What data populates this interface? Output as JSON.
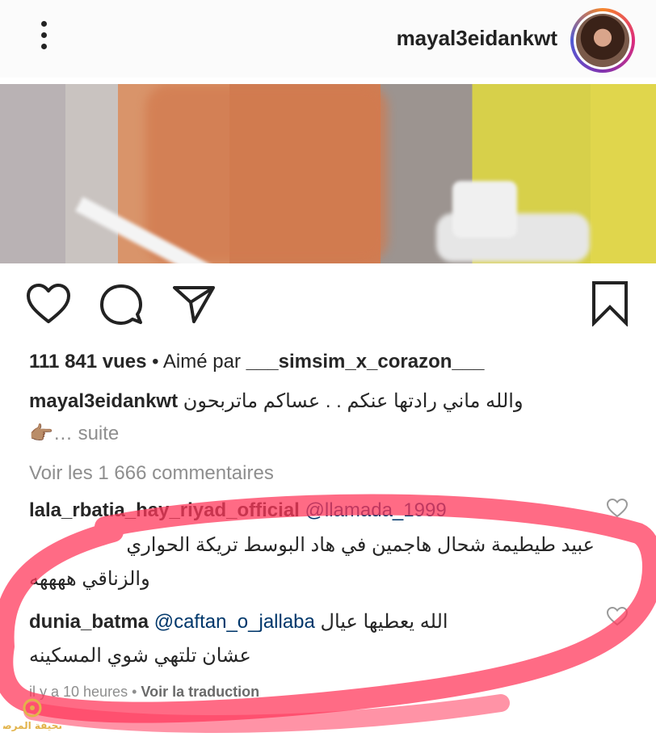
{
  "header": {
    "username": "mayal3eidankwt",
    "menu_icon": "more-vertical-icon"
  },
  "post": {
    "views_count": "111 841 vues",
    "liked_by_prefix": "• Aimé par",
    "liked_by_user": "___simsim_x_corazon___",
    "caption": {
      "username": "mayal3eidankwt",
      "text": "والله ماني رادتها عنكم . . عساكم ماتربحون",
      "continuation": "👉🏽…",
      "more": "suite"
    },
    "view_all_comments": "Voir les 1 666 commentaires"
  },
  "comments": [
    {
      "username": "lala_rbatia_hay_riyad_official",
      "mention": "@llamada_1999",
      "line1": "عبيد طيطيمة شحال هاجمين في هاد البوسط تريكة الحواري",
      "line2": "والزناقي ههههه"
    },
    {
      "username": "dunia_batma",
      "mention": "@caftan_o_jallaba",
      "inline_text": "الله يعطيها عيال",
      "line2": "عشان تلتهي  شوي المسكينه"
    }
  ],
  "comment_meta": {
    "time": "il y a 10 heures",
    "separator": "•",
    "translate": "Voir la traduction"
  },
  "watermark": {
    "text": "صحيفة المرصد"
  },
  "colors": {
    "marker": "#ff3a5c",
    "secondary_text": "#8e8e8e",
    "mention": "#00376b"
  }
}
